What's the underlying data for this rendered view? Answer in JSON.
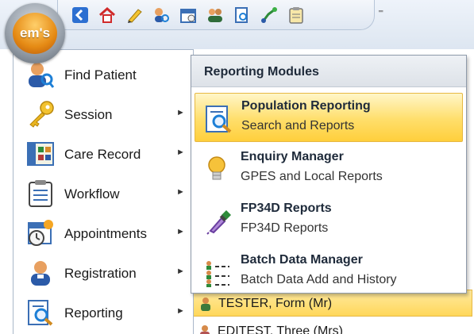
{
  "app": {
    "orb_label": "em's"
  },
  "qat": {
    "icons": [
      "back-icon",
      "home-icon",
      "edit-icon",
      "user-search-icon",
      "calendar-icon",
      "people-icon",
      "report-icon",
      "branch-icon",
      "clipboard-icon"
    ]
  },
  "menu": {
    "items": [
      {
        "label": "Find Patient",
        "icon": "find-patient-icon",
        "has_submenu": false
      },
      {
        "label": "Session",
        "icon": "key-icon",
        "has_submenu": true
      },
      {
        "label": "Care Record",
        "icon": "care-record-icon",
        "has_submenu": true
      },
      {
        "label": "Workflow",
        "icon": "workflow-icon",
        "has_submenu": true
      },
      {
        "label": "Appointments",
        "icon": "appointments-icon",
        "has_submenu": true
      },
      {
        "label": "Registration",
        "icon": "registration-icon",
        "has_submenu": true
      },
      {
        "label": "Reporting",
        "icon": "reporting-icon",
        "has_submenu": true
      }
    ]
  },
  "submenu": {
    "title": "Reporting Modules",
    "items": [
      {
        "title": "Population Reporting",
        "desc": "Search and Reports",
        "icon": "population-reporting-icon",
        "active": true
      },
      {
        "title": "Enquiry Manager",
        "desc": "GPES and Local Reports",
        "icon": "bulb-icon",
        "active": false
      },
      {
        "title": "FP34D Reports",
        "desc": "FP34D Reports",
        "icon": "pipette-icon",
        "active": false
      },
      {
        "title": "Batch Data Manager",
        "desc": "Batch Data Add and History",
        "icon": "batch-icon",
        "active": false
      }
    ]
  },
  "patient_list": {
    "rows": [
      {
        "name": "TESTER, Form (Mr)",
        "selected": true
      },
      {
        "name": "EDITEST, Three (Mrs)",
        "selected": false
      }
    ]
  },
  "colors": {
    "highlight": "#ffd75a",
    "accent": "#e58a14"
  }
}
